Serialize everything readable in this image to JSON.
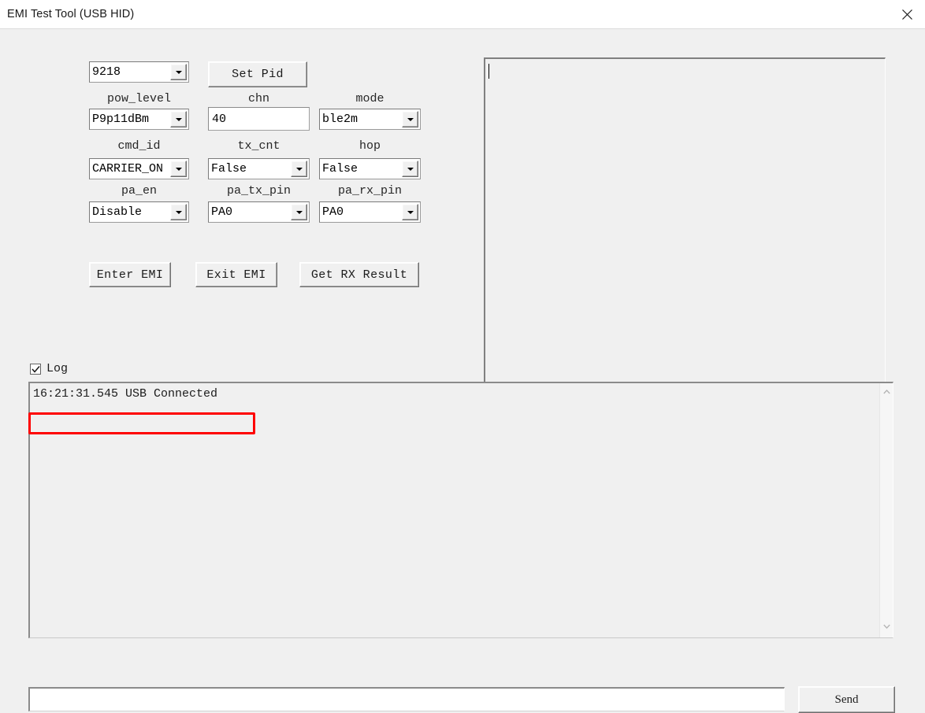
{
  "window": {
    "title": "EMI Test Tool (USB HID)",
    "close_icon": "close-icon",
    "bg_color": "#f0f0f0",
    "titlebar_color": "#ffffff"
  },
  "form": {
    "pid": {
      "label": "",
      "value": "9218",
      "type": "combobox"
    },
    "set_pid_button": {
      "label": "Set Pid"
    },
    "fields": [
      {
        "label": "pow_level",
        "value": "P9p11dBm",
        "type": "combobox"
      },
      {
        "label": "chn",
        "value": "40",
        "type": "entry"
      },
      {
        "label": "mode",
        "value": "ble2m",
        "type": "combobox"
      },
      {
        "label": "cmd_id",
        "value": "CARRIER_ON",
        "type": "combobox"
      },
      {
        "label": "tx_cnt",
        "value": "False",
        "type": "combobox"
      },
      {
        "label": "hop",
        "value": "False",
        "type": "combobox"
      },
      {
        "label": "pa_en",
        "value": "Disable",
        "type": "combobox"
      },
      {
        "label": "pa_tx_pin",
        "value": "PA0",
        "type": "combobox"
      },
      {
        "label": "pa_rx_pin",
        "value": "PA0",
        "type": "combobox"
      }
    ]
  },
  "actions": {
    "enter_emi": "Enter EMI",
    "exit_emi": "Exit EMI",
    "get_rx_result": "Get RX Result"
  },
  "output_panel": {
    "value": ""
  },
  "log_section": {
    "checkbox_label": "Log",
    "checkbox_checked": true,
    "entries": [
      "16:21:31.545 USB Connected"
    ],
    "highlight_color": "#fe0000"
  },
  "send_row": {
    "input_value": "",
    "input_placeholder": "",
    "button_label": "Send"
  }
}
